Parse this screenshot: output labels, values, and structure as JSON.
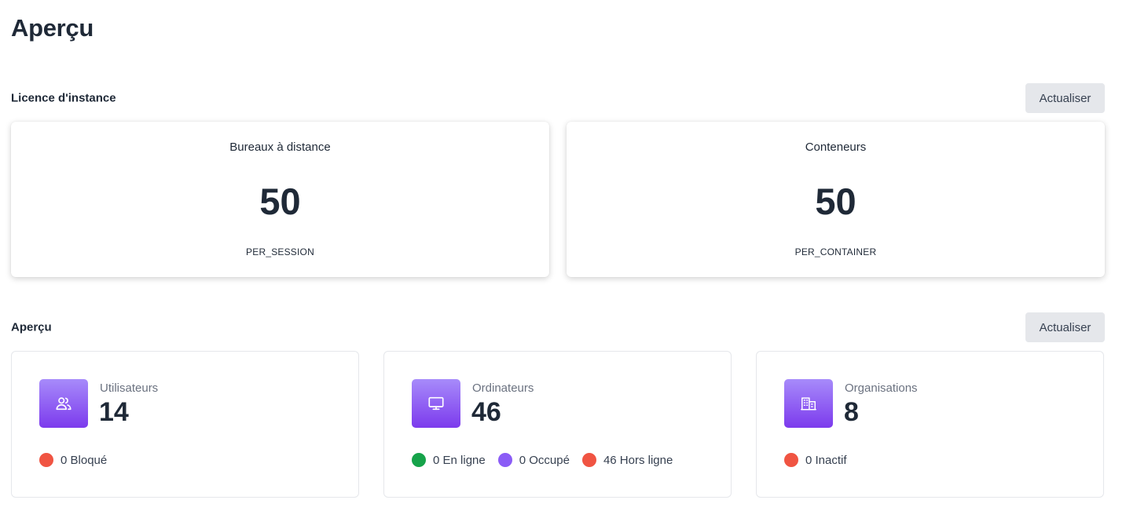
{
  "page": {
    "title": "Aperçu"
  },
  "license_section": {
    "title": "Licence d'instance",
    "refresh_label": "Actualiser",
    "cards": [
      {
        "label": "Bureaux à distance",
        "value": "50",
        "type": "PER_SESSION"
      },
      {
        "label": "Conteneurs",
        "value": "50",
        "type": "PER_CONTAINER"
      }
    ]
  },
  "overview_section": {
    "title": "Aperçu",
    "refresh_label": "Actualiser",
    "cards": [
      {
        "label": "Utilisateurs",
        "value": "14",
        "icon": "users-icon",
        "statuses": [
          {
            "text": "0 Bloqué",
            "color": "#f05442"
          }
        ]
      },
      {
        "label": "Ordinateurs",
        "value": "46",
        "icon": "monitor-icon",
        "statuses": [
          {
            "text": "0 En ligne",
            "color": "#16a34a"
          },
          {
            "text": "0 Occupé",
            "color": "#8b5cf6"
          },
          {
            "text": "46 Hors ligne",
            "color": "#f05442"
          }
        ]
      },
      {
        "label": "Organisations",
        "value": "8",
        "icon": "building-icon",
        "statuses": [
          {
            "text": "0 Inactif",
            "color": "#f05442"
          }
        ]
      }
    ]
  },
  "colors": {
    "accent_gradient_top": "#a78bfa",
    "accent_gradient_bottom": "#7c3aed",
    "button_bg": "#e5e7eb"
  }
}
